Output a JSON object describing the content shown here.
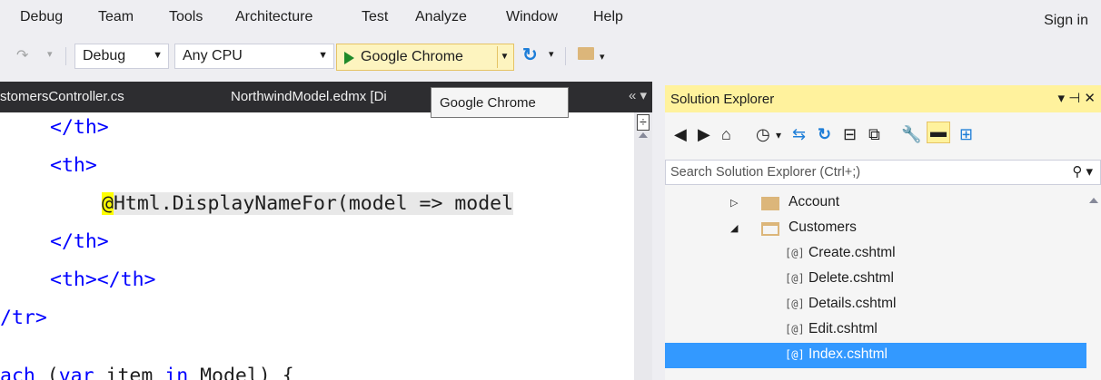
{
  "menu": {
    "items": [
      "Debug",
      "Team",
      "Tools",
      "Architecture",
      "Test",
      "Analyze",
      "Window",
      "Help"
    ],
    "sign_in": "Sign in"
  },
  "toolbar": {
    "configuration": "Debug",
    "platform": "Any CPU",
    "run_target": "Google Chrome"
  },
  "editor": {
    "tabs": [
      "stomersController.cs",
      "NorthwindModel.edmx [Di"
    ],
    "tooltip": "Google Chrome",
    "code": {
      "l1": "</th>",
      "l2": "<th>",
      "l3_razor": "@",
      "l3_rest": "Html.DisplayNameFor(model => model",
      "l4": "</th>",
      "l5": "<th></th>",
      "l6": "/tr>",
      "l7_kw1": "ach",
      "l7_mid": " (",
      "l7_kw2": "var",
      "l7_mid2": " item ",
      "l7_kw3": "in",
      "l7_end": " Model) {"
    }
  },
  "solution_explorer": {
    "title": "Solution Explorer",
    "title_controls": "▾ ⊣ ✕",
    "search_placeholder": "Search Solution Explorer (Ctrl+;)",
    "tree": [
      {
        "label": "Account",
        "type": "folder",
        "expanded": false
      },
      {
        "label": "Customers",
        "type": "folder",
        "expanded": true
      },
      {
        "label": "Create.cshtml",
        "type": "file"
      },
      {
        "label": "Delete.cshtml",
        "type": "file"
      },
      {
        "label": "Details.cshtml",
        "type": "file"
      },
      {
        "label": "Edit.cshtml",
        "type": "file"
      },
      {
        "label": "Index.cshtml",
        "type": "file",
        "selected": true
      }
    ],
    "file_icon": "[@]"
  },
  "colors": {
    "accent_title": "#fff29d",
    "selection": "#3399ff",
    "tab_bg": "#2d2d30",
    "run_button": "#fdf4bf"
  }
}
